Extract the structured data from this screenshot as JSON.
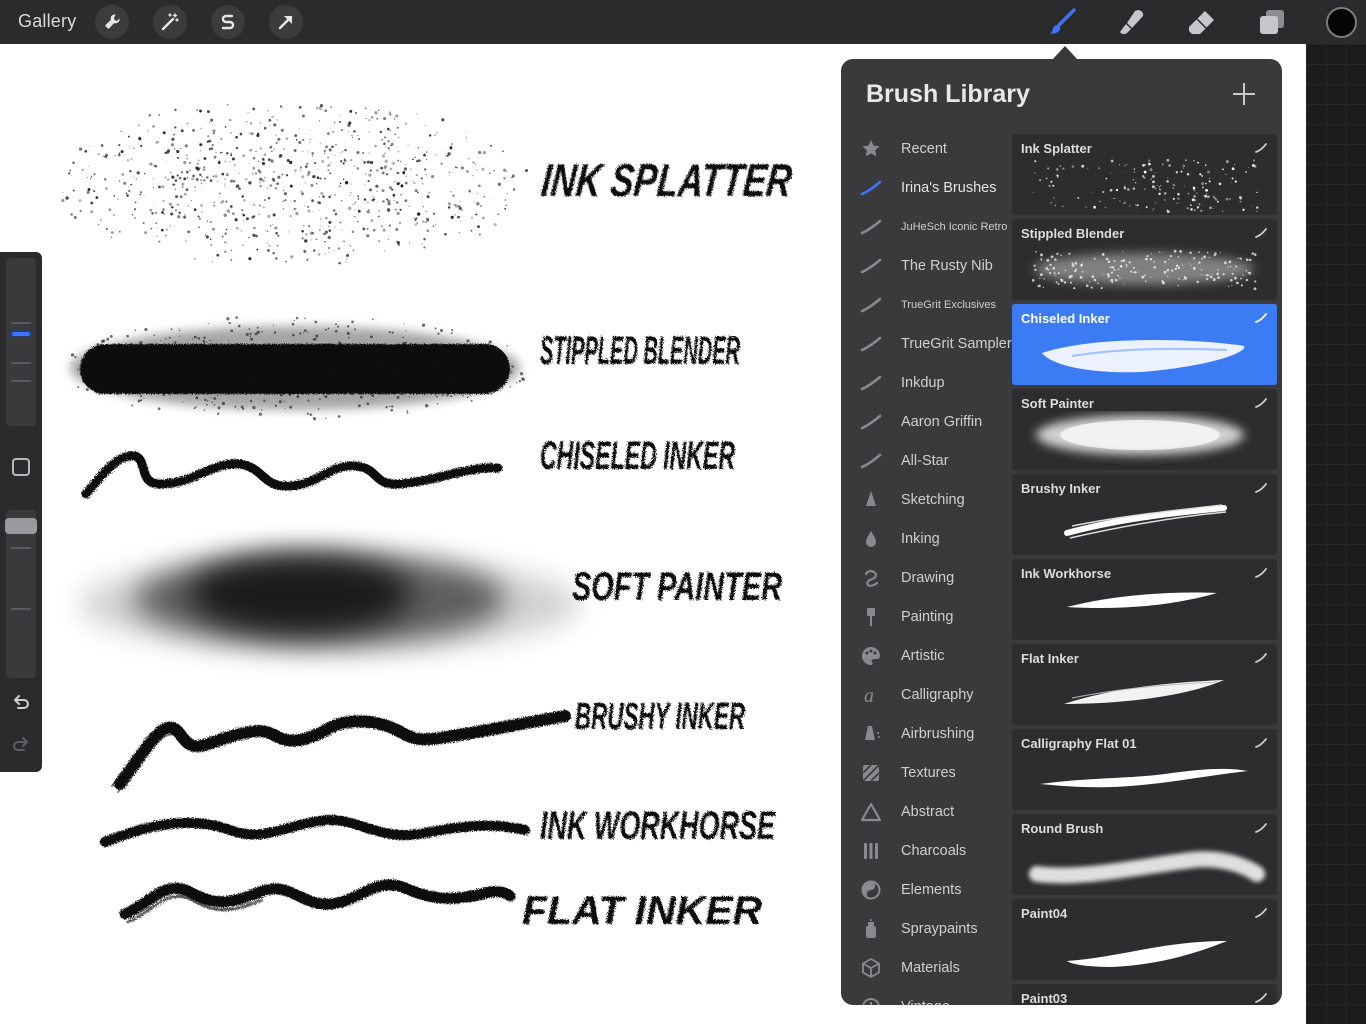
{
  "topbar": {
    "gallery_label": "Gallery",
    "left_icons": [
      "wrench-icon",
      "magic-wand-icon",
      "selection-s-icon",
      "transform-arrow-icon"
    ],
    "right_tools": [
      "brush-icon",
      "smudge-icon",
      "eraser-icon",
      "layers-icon"
    ],
    "active_tool": "brush",
    "current_color": "#050505",
    "accent_color": "#3a75ff"
  },
  "canvas": {
    "lettering": [
      "INK SPLATTER",
      "STIPPLED BLENDER",
      "CHISELED INKER",
      "SOFT PAINTER",
      "BRUSHY INKER",
      "INK WORKHORSE",
      "FLAT INKER"
    ]
  },
  "sidebar": {
    "brush_size_level": 0.55,
    "opacity_level": 0.95,
    "icons": [
      "modify-square-icon",
      "undo-icon",
      "redo-icon"
    ]
  },
  "brush_library": {
    "title": "Brush Library",
    "add_icon": "plus-icon",
    "sets": [
      {
        "label": "Recent",
        "icon": "star-icon"
      },
      {
        "label": "Irina's Brushes",
        "icon": "brush-stroke-icon",
        "selected": true
      },
      {
        "label": "JuHeSch Iconic Retro",
        "icon": "brush-stroke-icon"
      },
      {
        "label": "The Rusty Nib",
        "icon": "brush-stroke-icon"
      },
      {
        "label": "TrueGrit Exclusives",
        "icon": "brush-stroke-icon"
      },
      {
        "label": "TrueGrit Sampler",
        "icon": "brush-stroke-icon"
      },
      {
        "label": "Inkdup",
        "icon": "brush-stroke-icon"
      },
      {
        "label": "Aaron Griffin",
        "icon": "brush-stroke-icon"
      },
      {
        "label": "All-Star",
        "icon": "brush-stroke-icon"
      },
      {
        "label": "Sketching",
        "icon": "pencil-tip-icon"
      },
      {
        "label": "Inking",
        "icon": "ink-drop-icon"
      },
      {
        "label": "Drawing",
        "icon": "swirl-icon"
      },
      {
        "label": "Painting",
        "icon": "paint-brush-icon"
      },
      {
        "label": "Artistic",
        "icon": "palette-icon"
      },
      {
        "label": "Calligraphy",
        "icon": "calligraphy-a-icon"
      },
      {
        "label": "Airbrushing",
        "icon": "airbrush-icon"
      },
      {
        "label": "Textures",
        "icon": "texture-icon"
      },
      {
        "label": "Abstract",
        "icon": "triangle-icon"
      },
      {
        "label": "Charcoals",
        "icon": "charcoal-sticks-icon"
      },
      {
        "label": "Elements",
        "icon": "yin-yang-icon"
      },
      {
        "label": "Spraypaints",
        "icon": "spray-can-icon"
      },
      {
        "label": "Materials",
        "icon": "cube-icon"
      },
      {
        "label": "Vintage",
        "icon": "clock-icon"
      }
    ],
    "brushes": [
      {
        "name": "Ink Splatter",
        "preview": "splatter"
      },
      {
        "name": "Stippled Blender",
        "preview": "stipple"
      },
      {
        "name": "Chiseled Inker",
        "preview": "chisel",
        "selected": true
      },
      {
        "name": "Soft Painter",
        "preview": "soft"
      },
      {
        "name": "Brushy Inker",
        "preview": "brushy"
      },
      {
        "name": "Ink Workhorse",
        "preview": "workhorse"
      },
      {
        "name": "Flat Inker",
        "preview": "flat"
      },
      {
        "name": "Calligraphy Flat 01",
        "preview": "calligraphy"
      },
      {
        "name": "Round Brush",
        "preview": "round"
      },
      {
        "name": "Paint04",
        "preview": "paint04"
      },
      {
        "name": "Paint03",
        "preview": "paint03"
      }
    ]
  }
}
